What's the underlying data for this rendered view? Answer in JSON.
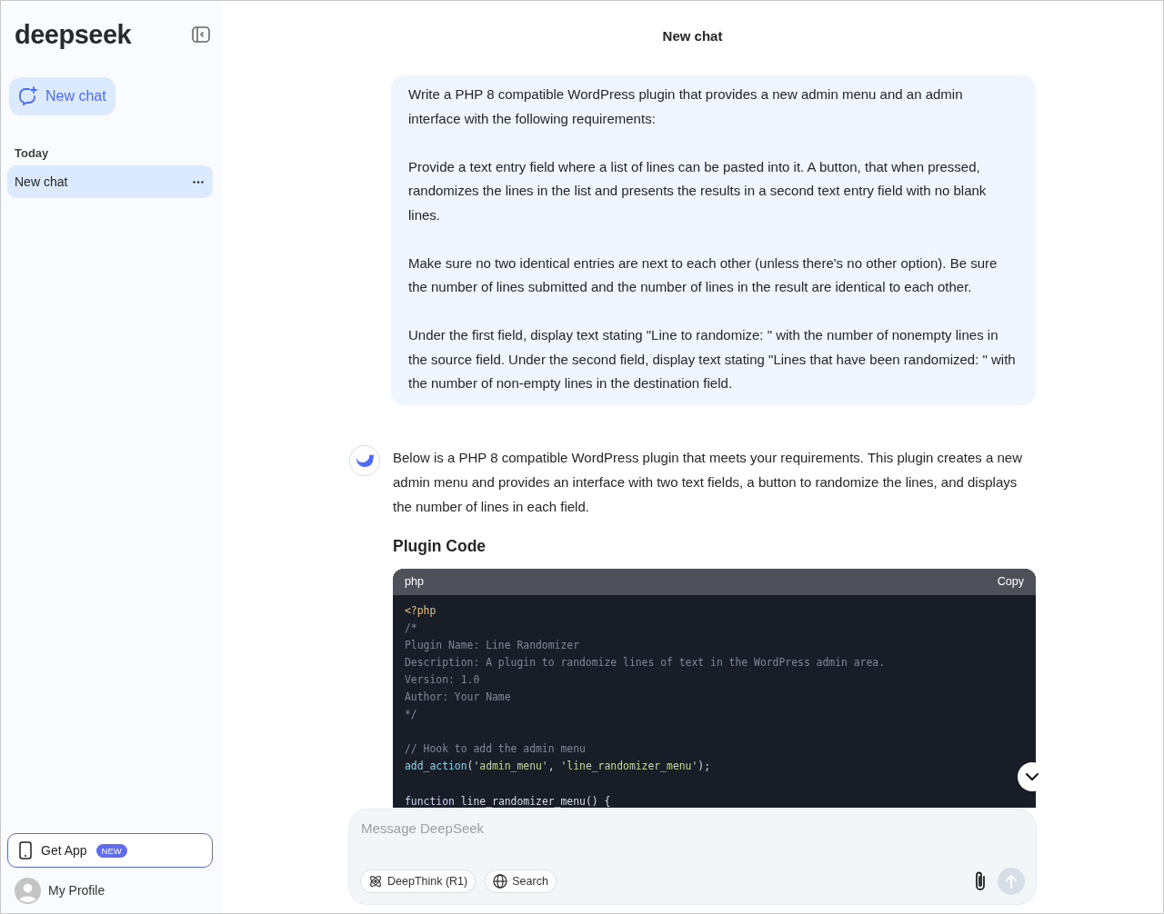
{
  "sidebar": {
    "logo": "deepseek",
    "new_chat_button": "New chat",
    "section_label": "Today",
    "chats": [
      {
        "title": "New chat",
        "selected": true
      }
    ],
    "get_app": {
      "label": "Get App",
      "badge": "NEW"
    },
    "profile": "My Profile"
  },
  "header": {
    "title": "New chat"
  },
  "user_message": {
    "paragraphs": [
      "Write a PHP 8 compatible WordPress plugin that provides a new admin menu and an admin interface with the following requirements:",
      "Provide a text entry field where a list of lines can be pasted into it. A button, that when pressed, randomizes the lines in the list and presents the results in a second text entry field with no blank lines.",
      "Make sure no two identical entries are next to each other (unless there's no other option). Be sure the number of lines submitted and the number of lines in the result are identical to each other.",
      "Under the first field, display text stating \"Line to randomize: \" with the number of nonempty lines in the source field. Under the second field, display text stating \"Lines that have been randomized: \" with the number of non-empty lines in the destination field."
    ]
  },
  "assistant_message": {
    "intro": "Below is a PHP 8 compatible WordPress plugin that meets your requirements. This plugin creates a new admin menu and provides an interface with two text fields, a button to randomize the lines, and displays the number of lines in each field.",
    "heading": "Plugin Code",
    "code_block": {
      "language": "php",
      "copy_label": "Copy",
      "lines": [
        {
          "blank_before": false,
          "tokens": [
            {
              "text": "<?php",
              "kind": "tag"
            }
          ]
        },
        {
          "blank_before": false,
          "tokens": [
            {
              "text": "/*",
              "kind": "comment"
            }
          ]
        },
        {
          "blank_before": false,
          "tokens": [
            {
              "text": "Plugin Name: Line Randomizer",
              "kind": "comment"
            }
          ]
        },
        {
          "blank_before": false,
          "tokens": [
            {
              "text": "Description: A plugin to randomize lines of text in the WordPress admin area.",
              "kind": "comment"
            }
          ]
        },
        {
          "blank_before": false,
          "tokens": [
            {
              "text": "Version: 1.0",
              "kind": "comment"
            }
          ]
        },
        {
          "blank_before": false,
          "tokens": [
            {
              "text": "Author: Your Name",
              "kind": "comment"
            }
          ]
        },
        {
          "blank_before": false,
          "tokens": [
            {
              "text": "*/",
              "kind": "comment"
            }
          ]
        },
        {
          "blank_before": true,
          "tokens": [
            {
              "text": "// Hook to add the admin menu",
              "kind": "comment"
            }
          ]
        },
        {
          "blank_before": false,
          "tokens": [
            {
              "text": "add_action",
              "kind": "func"
            },
            {
              "text": "(",
              "kind": "plain"
            },
            {
              "text": "'admin_menu'",
              "kind": "string"
            },
            {
              "text": ", ",
              "kind": "plain"
            },
            {
              "text": "'line_randomizer_menu'",
              "kind": "string"
            },
            {
              "text": ");",
              "kind": "plain"
            }
          ]
        },
        {
          "blank_before": true,
          "tokens": [
            {
              "text": "function",
              "kind": "keyword"
            },
            {
              "text": " line_randomizer_menu() {",
              "kind": "plain"
            }
          ]
        }
      ]
    }
  },
  "composer": {
    "placeholder": "Message DeepSeek",
    "deepthink": {
      "label": "DeepThink (R1)",
      "on": false
    },
    "search": {
      "label": "Search",
      "on": false
    }
  }
}
